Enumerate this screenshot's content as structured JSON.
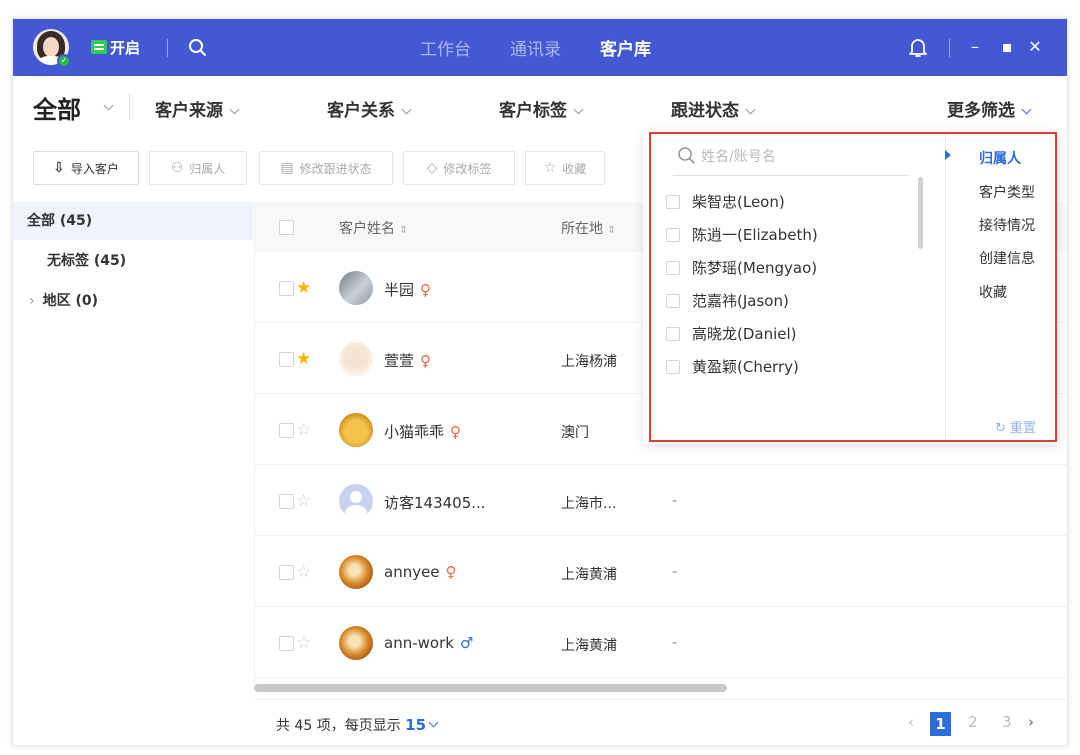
{
  "topbar": {
    "open_status": "开启",
    "nav_tabs": [
      "工作台",
      "通讯录",
      "客户库"
    ],
    "active_tab": "客户库",
    "window_controls": [
      "minimize-icon",
      "maximize-icon",
      "close-icon"
    ]
  },
  "filters": {
    "all": "全部",
    "items": [
      "客户来源",
      "客户关系",
      "客户标签",
      "跟进状态",
      "更多筛选"
    ]
  },
  "toolbar": {
    "import": "导入客户",
    "assign": "归属人",
    "change_status": "修改跟进状态",
    "change_tag": "修改标签",
    "favorite": "收藏"
  },
  "sidebar": {
    "all": "全部 (45)",
    "no_tag": "无标签 (45)",
    "region": "地区 (0)"
  },
  "table": {
    "headers": {
      "name": "客户姓名",
      "location": "所在地"
    },
    "rows": [
      {
        "name": "半园",
        "gender": "♀",
        "location": "",
        "status": "",
        "starred": true
      },
      {
        "name": "萱萱",
        "gender": "♀",
        "location": "上海杨浦",
        "status": "",
        "starred": true
      },
      {
        "name": "小猫乖乖",
        "gender": "♀",
        "location": "澳门",
        "status": "",
        "starred": false
      },
      {
        "name": "访客143405...",
        "gender": "",
        "location": "上海市...",
        "status": "-",
        "starred": false
      },
      {
        "name": "annyee",
        "gender": "♀",
        "location": "上海黄浦",
        "status": "-",
        "starred": false
      },
      {
        "name": "ann-work",
        "gender": "♂",
        "location": "上海黄浦",
        "status": "-",
        "starred": false
      }
    ]
  },
  "footer": {
    "total_prefix": "共 45 项，每页显示",
    "page_size": "15",
    "pages": [
      "1",
      "2",
      "3"
    ],
    "current_page": "1"
  },
  "dropdown": {
    "search_placeholder": "姓名/账号名",
    "owners": [
      "柴智忠(Leon)",
      "陈逍一(Elizabeth)",
      "陈梦瑶(Mengyao)",
      "范嘉祎(Jason)",
      "高晓龙(Daniel)",
      "黄盈颖(Cherry)"
    ],
    "categories": [
      "归属人",
      "客户类型",
      "接待情况",
      "创建信息",
      "收藏"
    ],
    "active_category": "归属人",
    "reset": "重置"
  },
  "colors": {
    "topbar": "#4359d4",
    "accent": "#2d6cdf",
    "status_green": "#36c957",
    "star": "#f5b800",
    "female": "#ef6a4a",
    "highlight_border": "#e53935"
  }
}
